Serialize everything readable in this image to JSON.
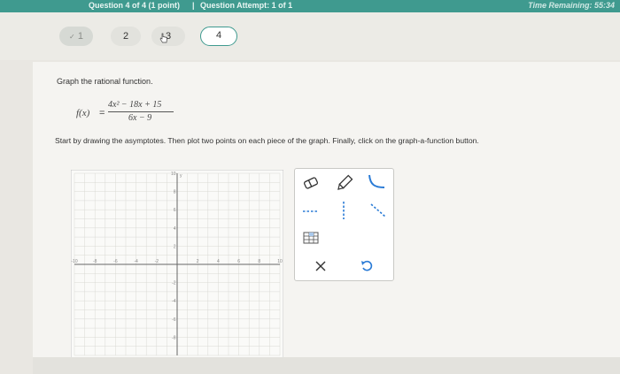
{
  "header": {
    "title": "Question 4 of 4 (1 point)",
    "separator": "|",
    "attempt": "Question Attempt: 1 of 1",
    "timer": "Time Remaining: 55:34"
  },
  "question_nav": {
    "items": [
      {
        "label": "1"
      },
      {
        "label": "2"
      },
      {
        "label": "3"
      },
      {
        "label": "4"
      }
    ]
  },
  "problem": {
    "prompt": "Graph the rational function.",
    "function_name": "f(x)",
    "equals": "=",
    "numerator": "4x² − 18x + 15",
    "denominator": "6x − 9",
    "instructions": "Start by drawing the asymptotes. Then plot two points on each piece of the graph. Finally, click on the graph-a-function button."
  },
  "graph": {
    "x_range": [
      -10,
      10
    ],
    "y_range": [
      -10,
      10
    ],
    "x_ticks": [
      "-10",
      "-8",
      "-6",
      "-4",
      "-2",
      "2",
      "4",
      "6",
      "8",
      "10"
    ],
    "y_ticks": [
      "10",
      "8",
      "6",
      "4",
      "2",
      "-2",
      "-4",
      "-6",
      "-8"
    ],
    "y_axis_label": "y",
    "x_axis_label": "x",
    "grid": true
  },
  "tools": {
    "items": [
      {
        "name": "eraser"
      },
      {
        "name": "pencil"
      },
      {
        "name": "curve"
      },
      {
        "name": "horizontal-dashed-line"
      },
      {
        "name": "vertical-dashed-line"
      },
      {
        "name": "oblique-dashed-line"
      },
      {
        "name": "table"
      },
      {
        "name": "clear"
      },
      {
        "name": "undo"
      }
    ]
  },
  "colors": {
    "header": "#3f9a8f",
    "accent": "#3f9a8f",
    "tool_blue": "#2a7bd6"
  }
}
